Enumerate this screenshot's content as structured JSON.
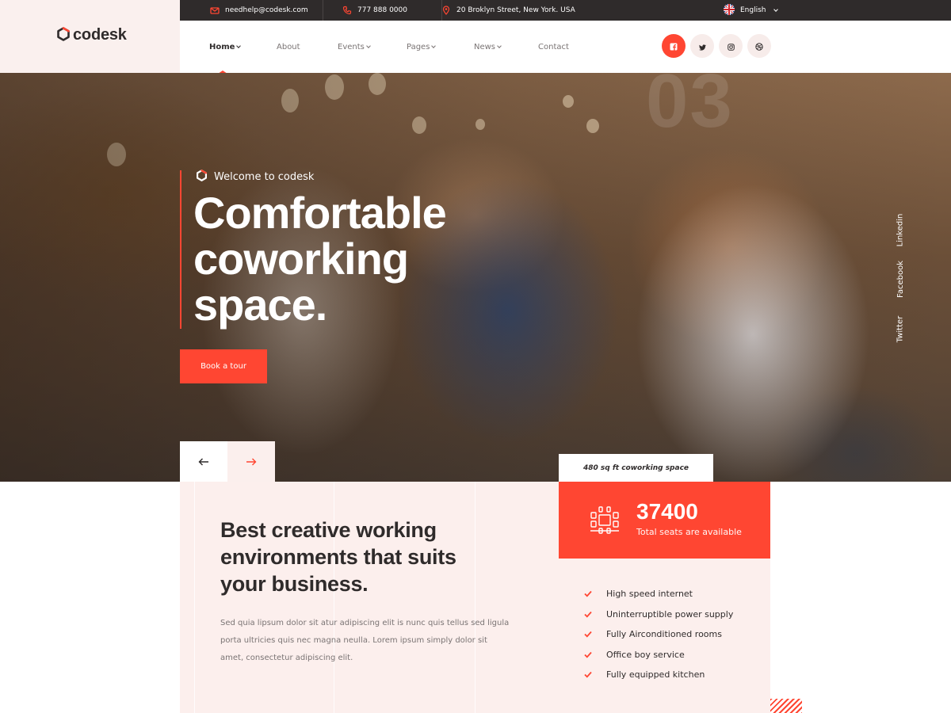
{
  "colors": {
    "accent": "#ff4632",
    "dark": "#2f2b2b",
    "muted": "#7a7474",
    "tint": "#fcefed"
  },
  "topbar": {
    "email": "needhelp@codesk.com",
    "phone": "777 888 0000",
    "address": "20 Broklyn Street, New York. USA",
    "language": "English"
  },
  "brand": {
    "name": "codesk"
  },
  "nav": {
    "items": [
      {
        "label": "Home",
        "has_dropdown": true,
        "active": true
      },
      {
        "label": "About",
        "has_dropdown": false
      },
      {
        "label": "Events",
        "has_dropdown": true
      },
      {
        "label": "Pages",
        "has_dropdown": true
      },
      {
        "label": "News",
        "has_dropdown": true
      },
      {
        "label": "Contact",
        "has_dropdown": false
      }
    ],
    "social_icons": [
      "facebook-icon",
      "twitter-icon",
      "instagram-icon",
      "dribbble-icon"
    ]
  },
  "hero": {
    "slide_number": "03",
    "tagline": "Welcome to codesk",
    "title_lines": [
      "Comfortable",
      "coworking",
      "space."
    ],
    "cta_label": "Book a tour",
    "vertical_social": [
      "Linkedin",
      "Facebook",
      "Twitter"
    ]
  },
  "about": {
    "headline_lines": [
      "Best creative working",
      "environments that suits",
      "your business."
    ],
    "body_lines": [
      "Sed quia lipsum dolor sit atur adipiscing elit is nunc quis tellus sed ligula",
      "porta ultricies quis nec magna neulla. Lorem ipsum simply dolor sit",
      "amet, consectetur adipiscing elit."
    ]
  },
  "stats": {
    "space_tag": "480 sq ft coworking space",
    "seats_number": "37400",
    "seats_label": "Total seats are available"
  },
  "features": [
    "High speed internet",
    "Uninterruptible power supply",
    "Fully Airconditioned rooms",
    "Office boy service",
    "Fully equipped kitchen"
  ]
}
